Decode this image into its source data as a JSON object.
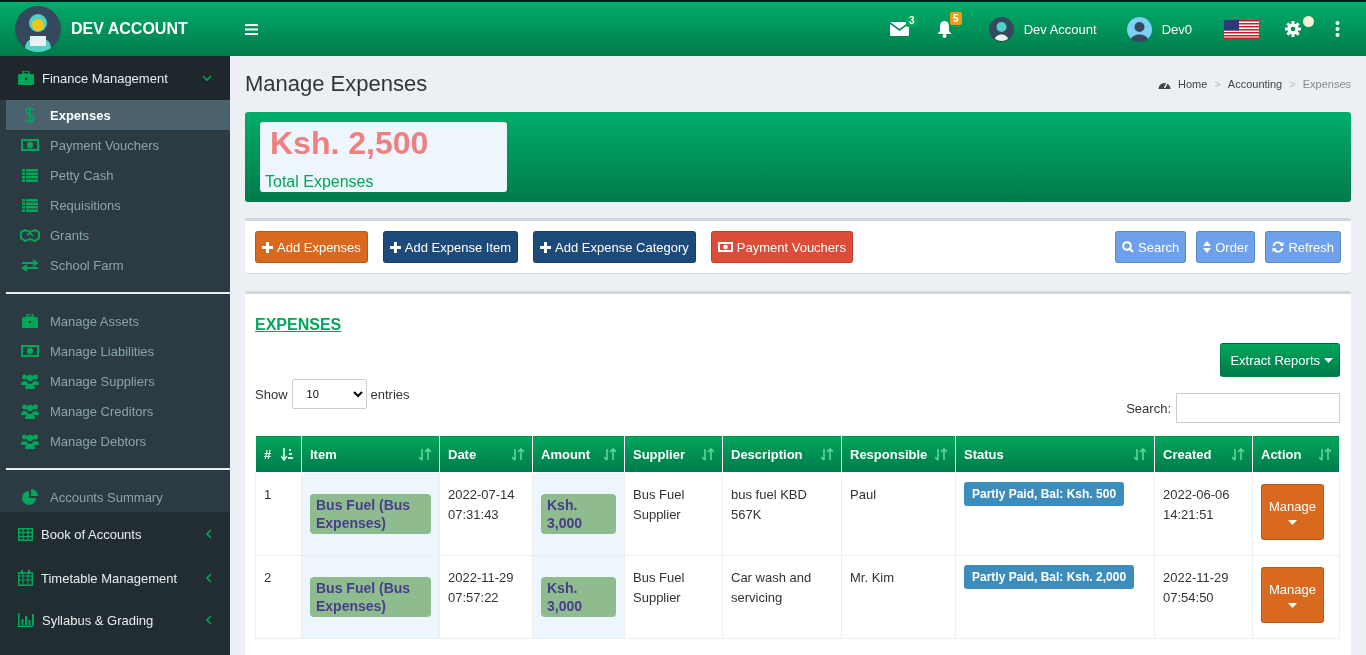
{
  "header": {
    "brand": "DEV ACCOUNT",
    "notifications": [
      {
        "count": "3",
        "color": "#00a65a"
      },
      {
        "count": "5",
        "color": "#f39c12"
      }
    ],
    "users": [
      "Dev Account",
      "Dev0"
    ]
  },
  "sidebar": {
    "menus": [
      {
        "label": "Finance Management",
        "expanded": true,
        "groups": [
          [
            {
              "label": "Expenses",
              "selected": true
            },
            {
              "label": "Payment Vouchers",
              "selected": false
            },
            {
              "label": "Petty Cash",
              "selected": false
            },
            {
              "label": "Requisitions",
              "selected": false
            },
            {
              "label": "Grants",
              "selected": false
            },
            {
              "label": "School Farm",
              "selected": false
            }
          ],
          [
            {
              "label": "Manage Assets",
              "selected": false
            },
            {
              "label": "Manage Liabilities",
              "selected": false
            },
            {
              "label": "Manage Suppliers",
              "selected": false
            },
            {
              "label": "Manage Creditors",
              "selected": false
            },
            {
              "label": "Manage Debtors",
              "selected": false
            }
          ],
          [
            {
              "label": "Accounts Summary",
              "selected": false
            }
          ]
        ]
      },
      {
        "label": "Book of Accounts",
        "expanded": false
      },
      {
        "label": "Timetable Management",
        "expanded": false
      },
      {
        "label": "Syllabus & Grading",
        "expanded": false
      }
    ]
  },
  "page": {
    "title": "Manage Expenses",
    "breadcrumb": {
      "separator": ">",
      "items": [
        {
          "label": "Home",
          "selected": false
        },
        {
          "label": "Accounting",
          "selected": false
        },
        {
          "label": "Expenses",
          "selected": true
        }
      ]
    }
  },
  "stat": {
    "value": "Ksh. 2,500",
    "label": "Total Expenses"
  },
  "toolbar": {
    "left": [
      {
        "label": "Add Expenses",
        "color": "#d9691f"
      },
      {
        "label": "Add Expense Item",
        "color": "#1e4a7a"
      },
      {
        "label": "Add Expense Category",
        "color": "#1e4a7a"
      },
      {
        "label": "Payment Vouchers",
        "color": "#dd4b39"
      }
    ],
    "right": [
      {
        "label": "Search",
        "color": "#6ea0ec"
      },
      {
        "label": "Order",
        "color": "#6ea0ec"
      },
      {
        "label": "Refresh",
        "color": "#6ea0ec"
      }
    ]
  },
  "table_section": {
    "title": "EXPENSES",
    "extract_button": "Extract Reports",
    "show_label": "Show",
    "entries_value": "10",
    "entries_label": "entries",
    "search_label": "Search:",
    "columns": [
      {
        "label": "#",
        "sorted": true,
        "shaded": false
      },
      {
        "label": "Item",
        "sorted": false,
        "shaded": true
      },
      {
        "label": "Date",
        "sorted": false,
        "shaded": false
      },
      {
        "label": "Amount",
        "sorted": false,
        "shaded": true
      },
      {
        "label": "Supplier",
        "sorted": false,
        "shaded": false
      },
      {
        "label": "Description",
        "sorted": false,
        "shaded": false
      },
      {
        "label": "Responsible",
        "sorted": false,
        "shaded": false
      },
      {
        "label": "Status",
        "sorted": false,
        "shaded": false
      },
      {
        "label": "Created",
        "sorted": false,
        "shaded": false
      },
      {
        "label": "Action",
        "sorted": false,
        "shaded": false
      }
    ],
    "rows": [
      {
        "number": "1",
        "item": "Bus Fuel (Bus Expenses)",
        "date": "2022-07-14 07:31:43",
        "amount": "Ksh. 3,000",
        "supplier": "Bus Fuel Supplier",
        "description": "bus fuel KBD 567K",
        "responsible": "Paul",
        "status": {
          "text": "Partly Paid, Bal: Ksh. 500",
          "color": "#3c8dbc"
        },
        "created": "2022-06-06 14:21:51",
        "action": "Manage"
      },
      {
        "number": "2",
        "item": "Bus Fuel (Bus Expenses)",
        "date": "2022-11-29 07:57:22",
        "amount": "Ksh. 3,000",
        "supplier": "Bus Fuel Supplier",
        "description": "Car wash and servicing",
        "responsible": "Mr. Kim",
        "status": {
          "text": "Partly Paid, Bal: Ksh. 2,000",
          "color": "#3c8dbc"
        },
        "created": "2022-11-29 07:54:50",
        "action": "Manage"
      }
    ]
  }
}
